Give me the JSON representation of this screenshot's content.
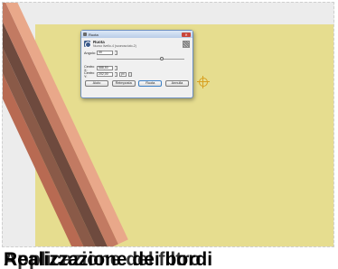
{
  "dialog": {
    "title": "Ruota",
    "header_title": "Ruota",
    "header_subtitle": "Nuovo livello-4 (sconosciuto-2)",
    "angle_label": "Angolo:",
    "angle_value": "30",
    "center_x_label": "Centro X:",
    "center_x_value": "588,50",
    "center_y_label": "Centro Y:",
    "center_y_value": "202,00",
    "unit_value": "px",
    "buttons": {
      "help": "Aiuto",
      "reset": "Reimposta",
      "rotate": "Ruota",
      "cancel": "Annulla"
    }
  },
  "caption": {
    "text_a": "Realizzazione dei bordi",
    "text_b": "Applicazione del filtro"
  },
  "colors": {
    "canvas_bg": "#ececec",
    "image_bg": "#e6dd8f",
    "stripes": [
      "#b86a52",
      "#8a5a48",
      "#6e4a3e",
      "#c27a62",
      "#e9a88a"
    ]
  }
}
